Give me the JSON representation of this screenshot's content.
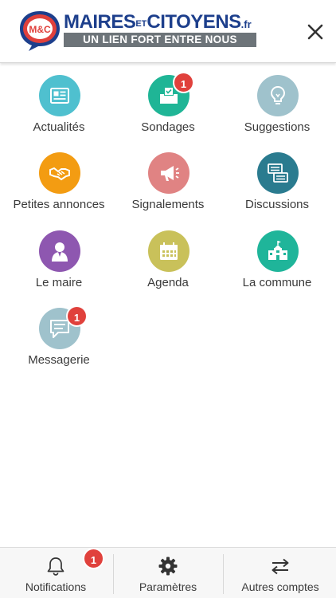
{
  "header": {
    "logo": {
      "badge_text": "M&C",
      "title_part1": "MAIRES",
      "title_part2": "ET",
      "title_part3": "CITOYENS",
      "title_part4": ".fr",
      "tagline": "UN LIEN FORT ENTRE NOUS"
    },
    "close_icon": "close-icon"
  },
  "grid": {
    "items": [
      {
        "label": "Actualités",
        "icon": "newspaper-icon",
        "color": "#4fc0cf",
        "badge": ""
      },
      {
        "label": "Sondages",
        "icon": "ballot-box-icon",
        "color": "#1fb596",
        "badge": "1"
      },
      {
        "label": "Suggestions",
        "icon": "lightbulb-icon",
        "color": "#9fc2cc",
        "badge": ""
      },
      {
        "label": "Petites annonces",
        "icon": "handshake-icon",
        "color": "#f39c12",
        "badge": ""
      },
      {
        "label": "Signalements",
        "icon": "megaphone-icon",
        "color": "#e08383",
        "badge": ""
      },
      {
        "label": "Discussions",
        "icon": "chat-bubbles-icon",
        "color": "#2a7b8f",
        "badge": ""
      },
      {
        "label": "Le maire",
        "icon": "person-icon",
        "color": "#8e57b0",
        "badge": ""
      },
      {
        "label": "Agenda",
        "icon": "calendar-icon",
        "color": "#c9c15a",
        "badge": ""
      },
      {
        "label": "La commune",
        "icon": "town-hall-icon",
        "color": "#1fb59a",
        "badge": ""
      },
      {
        "label": "Messagerie",
        "icon": "message-icon",
        "color": "#9fc2cc",
        "badge": "1"
      }
    ]
  },
  "bottombar": {
    "notifications": {
      "label": "Notifications",
      "icon": "bell-icon",
      "badge": "1"
    },
    "parametres": {
      "label": "Paramètres",
      "icon": "gear-icon"
    },
    "autres_comptes": {
      "label": "Autres comptes",
      "icon": "swap-arrows-icon"
    }
  },
  "colors": {
    "brand_blue": "#1d3f8c",
    "brand_red": "#e0413c",
    "tagline_bg": "#6d7479",
    "badge": "#e0413c"
  }
}
